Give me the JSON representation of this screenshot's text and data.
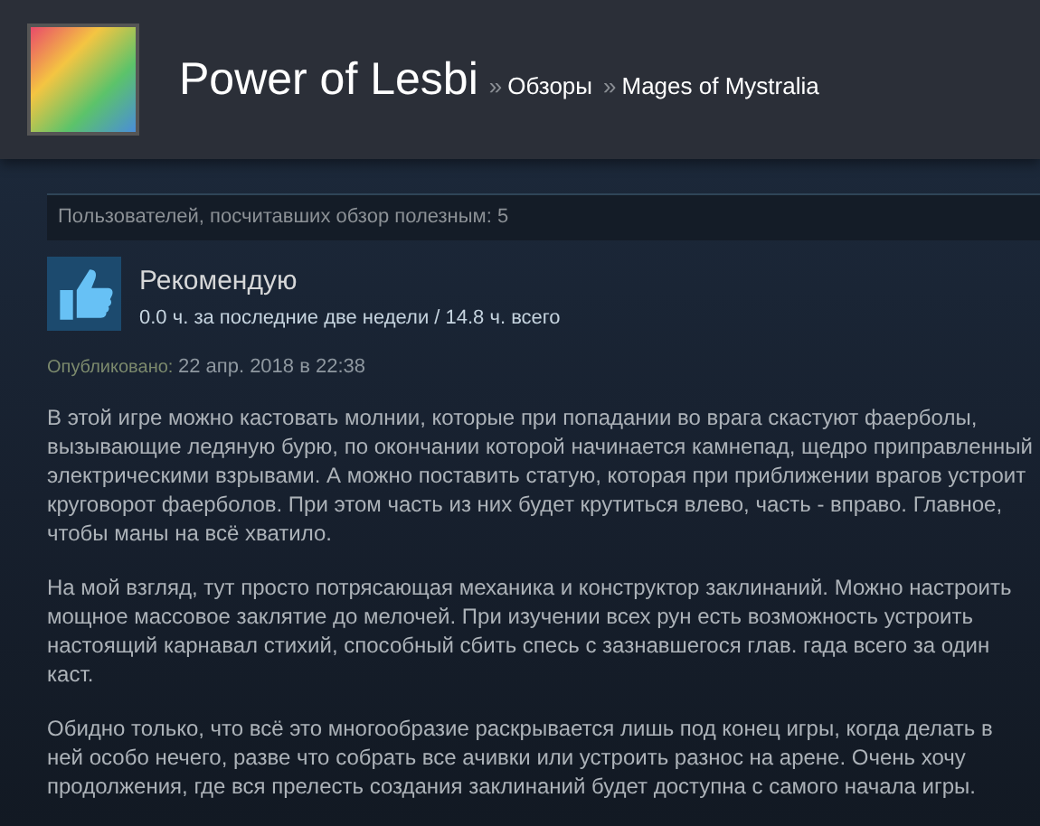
{
  "header": {
    "author": "Power of Lesbi",
    "breadcrumbs": [
      {
        "separator": "»",
        "label": "Обзоры"
      },
      {
        "separator": "»",
        "label": "Mages of Mystralia"
      }
    ]
  },
  "helpful": "Пользователей, посчитавших обзор полезным: 5",
  "review": {
    "verdict": "Рекомендую",
    "kind": "positive",
    "hours": "0.0 ч. за последние две недели / 14.8 ч. всего",
    "posted_label": "Опубликовано:",
    "posted": "22 апр. 2018 в 22:38"
  },
  "paragraphs": [
    "В этой игре можно кастовать молнии, которые при попадании во врага скастуют фаерболы, вызывающие ледяную бурю, по окончании которой начинается камнепад, щедро приправленный электрическими взрывами. А можно поставить статую, которая при приближении врагов устроит круговорот фаерболов. При этом часть из них будет крутиться влево, часть - вправо. Главное, чтобы маны на всё хватило.",
    "На мой взгляд, тут просто потрясающая механика и конструктор заклинаний. Можно настроить мощное массовое заклятие до мелочей. При изучении всех рун есть возможность устроить настоящий карнавал стихий, способный сбить спесь с зазнавшегося глав. гада всего за один каст.",
    "Обидно только, что всё это многообразие раскрывается лишь под конец игры, когда делать в ней особо нечего, разве что собрать все ачивки или устроить разнос на арене. Очень хочу продолжения, где вся прелесть создания заклинаний будет доступна с самого начала игры."
  ]
}
